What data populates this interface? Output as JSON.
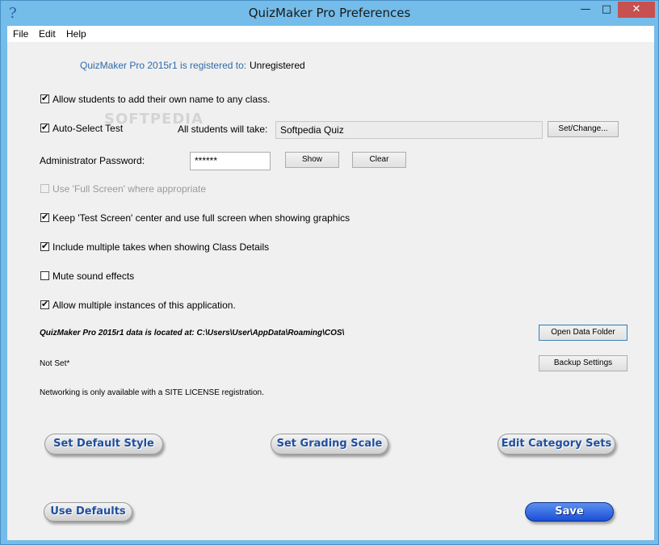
{
  "window": {
    "title": "QuizMaker Pro Preferences",
    "help_glyph": "?",
    "minimize_glyph": "—",
    "maximize_glyph": "□",
    "close_glyph": "✕"
  },
  "menu": {
    "file": "File",
    "edit": "Edit",
    "help": "Help"
  },
  "registration": {
    "label": "QuizMaker Pro 2015r1 is registered to:",
    "value": "Unregistered"
  },
  "options": {
    "allow_names": {
      "label": "Allow students to add their own name to any class.",
      "checked": true
    },
    "auto_select": {
      "label": "Auto-Select Test",
      "checked": true
    },
    "full_screen": {
      "label": "Use 'Full Screen' where appropriate",
      "checked": false,
      "disabled": true
    },
    "keep_center": {
      "label": "Keep 'Test Screen' center and use full screen when showing graphics",
      "checked": true
    },
    "multiple_takes": {
      "label": "Include multiple takes when showing Class Details",
      "checked": true
    },
    "mute_sound": {
      "label": "Mute sound effects",
      "checked": false
    },
    "multiple_instances": {
      "label": "Allow multiple instances of this application.",
      "checked": true
    }
  },
  "test": {
    "label": "All students will take:",
    "value": "Softpedia Quiz",
    "set_change": "Set/Change..."
  },
  "password": {
    "label": "Administrator Password:",
    "value": "******",
    "show": "Show",
    "clear": "Clear"
  },
  "data_folder": {
    "text": "QuizMaker Pro 2015r1 data is located at: C:\\Users\\User\\AppData\\Roaming\\COS\\",
    "open_button": "Open Data Folder"
  },
  "backup": {
    "status": "Not Set*",
    "button": "Backup Settings"
  },
  "network_note": "Networking is only available with a SITE LICENSE registration.",
  "actions": {
    "set_default_style": "Set Default Style",
    "set_grading_scale": "Set Grading Scale",
    "edit_category_sets": "Edit Category Sets",
    "use_defaults": "Use Defaults",
    "save": "Save"
  },
  "watermark": "SOFTPEDIA"
}
